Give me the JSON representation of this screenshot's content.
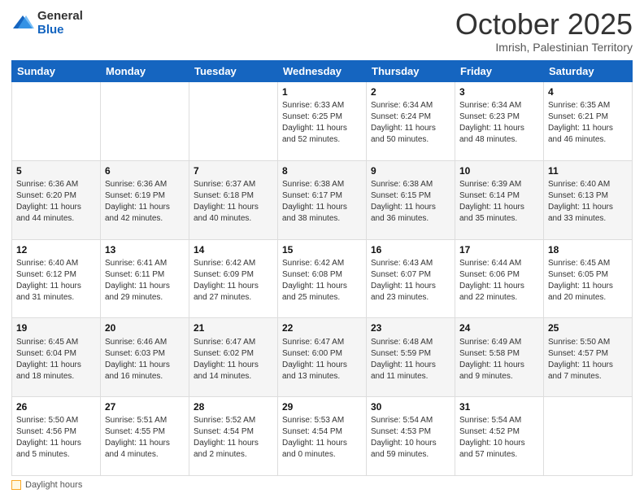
{
  "logo": {
    "general": "General",
    "blue": "Blue"
  },
  "header": {
    "month": "October 2025",
    "location": "Imrish, Palestinian Territory"
  },
  "days_of_week": [
    "Sunday",
    "Monday",
    "Tuesday",
    "Wednesday",
    "Thursday",
    "Friday",
    "Saturday"
  ],
  "weeks": [
    [
      {
        "day": "",
        "info": ""
      },
      {
        "day": "",
        "info": ""
      },
      {
        "day": "",
        "info": ""
      },
      {
        "day": "1",
        "info": "Sunrise: 6:33 AM\nSunset: 6:25 PM\nDaylight: 11 hours\nand 52 minutes."
      },
      {
        "day": "2",
        "info": "Sunrise: 6:34 AM\nSunset: 6:24 PM\nDaylight: 11 hours\nand 50 minutes."
      },
      {
        "day": "3",
        "info": "Sunrise: 6:34 AM\nSunset: 6:23 PM\nDaylight: 11 hours\nand 48 minutes."
      },
      {
        "day": "4",
        "info": "Sunrise: 6:35 AM\nSunset: 6:21 PM\nDaylight: 11 hours\nand 46 minutes."
      }
    ],
    [
      {
        "day": "5",
        "info": "Sunrise: 6:36 AM\nSunset: 6:20 PM\nDaylight: 11 hours\nand 44 minutes."
      },
      {
        "day": "6",
        "info": "Sunrise: 6:36 AM\nSunset: 6:19 PM\nDaylight: 11 hours\nand 42 minutes."
      },
      {
        "day": "7",
        "info": "Sunrise: 6:37 AM\nSunset: 6:18 PM\nDaylight: 11 hours\nand 40 minutes."
      },
      {
        "day": "8",
        "info": "Sunrise: 6:38 AM\nSunset: 6:17 PM\nDaylight: 11 hours\nand 38 minutes."
      },
      {
        "day": "9",
        "info": "Sunrise: 6:38 AM\nSunset: 6:15 PM\nDaylight: 11 hours\nand 36 minutes."
      },
      {
        "day": "10",
        "info": "Sunrise: 6:39 AM\nSunset: 6:14 PM\nDaylight: 11 hours\nand 35 minutes."
      },
      {
        "day": "11",
        "info": "Sunrise: 6:40 AM\nSunset: 6:13 PM\nDaylight: 11 hours\nand 33 minutes."
      }
    ],
    [
      {
        "day": "12",
        "info": "Sunrise: 6:40 AM\nSunset: 6:12 PM\nDaylight: 11 hours\nand 31 minutes."
      },
      {
        "day": "13",
        "info": "Sunrise: 6:41 AM\nSunset: 6:11 PM\nDaylight: 11 hours\nand 29 minutes."
      },
      {
        "day": "14",
        "info": "Sunrise: 6:42 AM\nSunset: 6:09 PM\nDaylight: 11 hours\nand 27 minutes."
      },
      {
        "day": "15",
        "info": "Sunrise: 6:42 AM\nSunset: 6:08 PM\nDaylight: 11 hours\nand 25 minutes."
      },
      {
        "day": "16",
        "info": "Sunrise: 6:43 AM\nSunset: 6:07 PM\nDaylight: 11 hours\nand 23 minutes."
      },
      {
        "day": "17",
        "info": "Sunrise: 6:44 AM\nSunset: 6:06 PM\nDaylight: 11 hours\nand 22 minutes."
      },
      {
        "day": "18",
        "info": "Sunrise: 6:45 AM\nSunset: 6:05 PM\nDaylight: 11 hours\nand 20 minutes."
      }
    ],
    [
      {
        "day": "19",
        "info": "Sunrise: 6:45 AM\nSunset: 6:04 PM\nDaylight: 11 hours\nand 18 minutes."
      },
      {
        "day": "20",
        "info": "Sunrise: 6:46 AM\nSunset: 6:03 PM\nDaylight: 11 hours\nand 16 minutes."
      },
      {
        "day": "21",
        "info": "Sunrise: 6:47 AM\nSunset: 6:02 PM\nDaylight: 11 hours\nand 14 minutes."
      },
      {
        "day": "22",
        "info": "Sunrise: 6:47 AM\nSunset: 6:00 PM\nDaylight: 11 hours\nand 13 minutes."
      },
      {
        "day": "23",
        "info": "Sunrise: 6:48 AM\nSunset: 5:59 PM\nDaylight: 11 hours\nand 11 minutes."
      },
      {
        "day": "24",
        "info": "Sunrise: 6:49 AM\nSunset: 5:58 PM\nDaylight: 11 hours\nand 9 minutes."
      },
      {
        "day": "25",
        "info": "Sunrise: 5:50 AM\nSunset: 4:57 PM\nDaylight: 11 hours\nand 7 minutes."
      }
    ],
    [
      {
        "day": "26",
        "info": "Sunrise: 5:50 AM\nSunset: 4:56 PM\nDaylight: 11 hours\nand 5 minutes."
      },
      {
        "day": "27",
        "info": "Sunrise: 5:51 AM\nSunset: 4:55 PM\nDaylight: 11 hours\nand 4 minutes."
      },
      {
        "day": "28",
        "info": "Sunrise: 5:52 AM\nSunset: 4:54 PM\nDaylight: 11 hours\nand 2 minutes."
      },
      {
        "day": "29",
        "info": "Sunrise: 5:53 AM\nSunset: 4:54 PM\nDaylight: 11 hours\nand 0 minutes."
      },
      {
        "day": "30",
        "info": "Sunrise: 5:54 AM\nSunset: 4:53 PM\nDaylight: 10 hours\nand 59 minutes."
      },
      {
        "day": "31",
        "info": "Sunrise: 5:54 AM\nSunset: 4:52 PM\nDaylight: 10 hours\nand 57 minutes."
      },
      {
        "day": "",
        "info": ""
      }
    ]
  ],
  "footer": {
    "daylight_label": "Daylight hours"
  }
}
